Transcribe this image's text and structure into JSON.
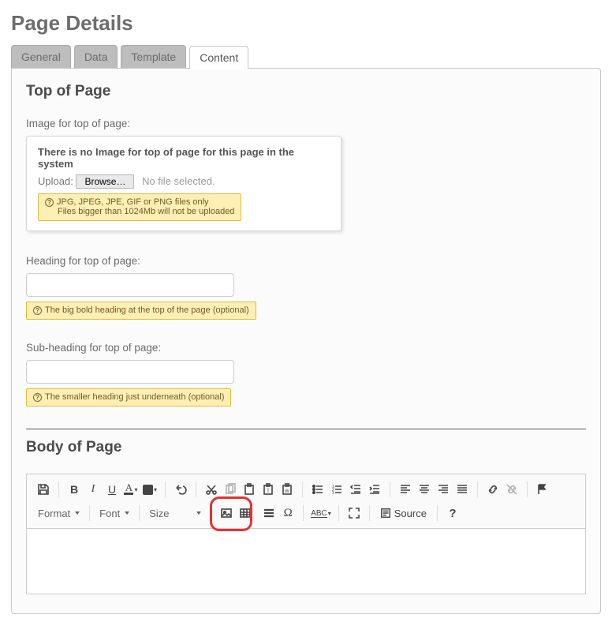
{
  "page_title": "Page Details",
  "tabs": {
    "general": "General",
    "data": "Data",
    "template": "Template",
    "content": "Content"
  },
  "sections": {
    "top": {
      "title": "Top of Page",
      "image_field": {
        "label": "Image for top of page:",
        "empty_text": "There is no Image for top of page for this page in the system",
        "upload_label": "Upload:",
        "browse_label": "Browse…",
        "no_file_text": "No file selected.",
        "hint_line1": "JPG, JPEG, JPE, GIF or PNG files only",
        "hint_line2": "Files bigger than 1024Mb will not be uploaded"
      },
      "heading_field": {
        "label": "Heading for top of page:",
        "value": "",
        "hint": "The big bold heading at the top of the page (optional)"
      },
      "subheading_field": {
        "label": "Sub-heading for top of page:",
        "value": "",
        "hint": "The smaller heading just underneath (optional)"
      }
    },
    "body": {
      "title": "Body of Page",
      "editor": {
        "format_label": "Format",
        "font_label": "Font",
        "size_label": "Size",
        "source_label": "Source"
      }
    }
  }
}
